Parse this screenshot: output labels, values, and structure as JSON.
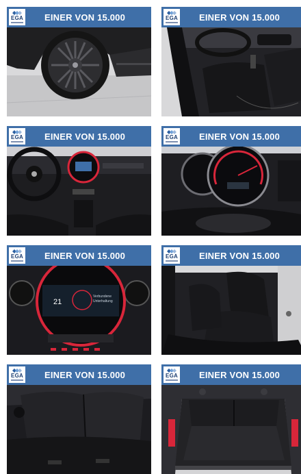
{
  "tiles": [
    {
      "logo": "EGA",
      "title": "EINER VON 15.000",
      "subject": "wheel"
    },
    {
      "logo": "EGA",
      "title": "EINER VON 15.000",
      "subject": "driver-seat"
    },
    {
      "logo": "EGA",
      "title": "EINER VON 15.000",
      "subject": "dashboard"
    },
    {
      "logo": "EGA",
      "title": "EINER VON 15.000",
      "subject": "gauges"
    },
    {
      "logo": "EGA",
      "title": "EINER VON 15.000",
      "subject": "infotainment"
    },
    {
      "logo": "EGA",
      "title": "EINER VON 15.000",
      "subject": "front-seats"
    },
    {
      "logo": "EGA",
      "title": "EINER VON 15.000",
      "subject": "rear-seats"
    },
    {
      "logo": "EGA",
      "title": "EINER VON 15.000",
      "subject": "trunk"
    }
  ],
  "screen": {
    "day": "21",
    "label1": "Verbundene",
    "label2": "Unterhaltung"
  },
  "colors": {
    "banner": "#3f6fa8",
    "logo_text": "#1d3f72",
    "accent_red": "#d8263a"
  }
}
